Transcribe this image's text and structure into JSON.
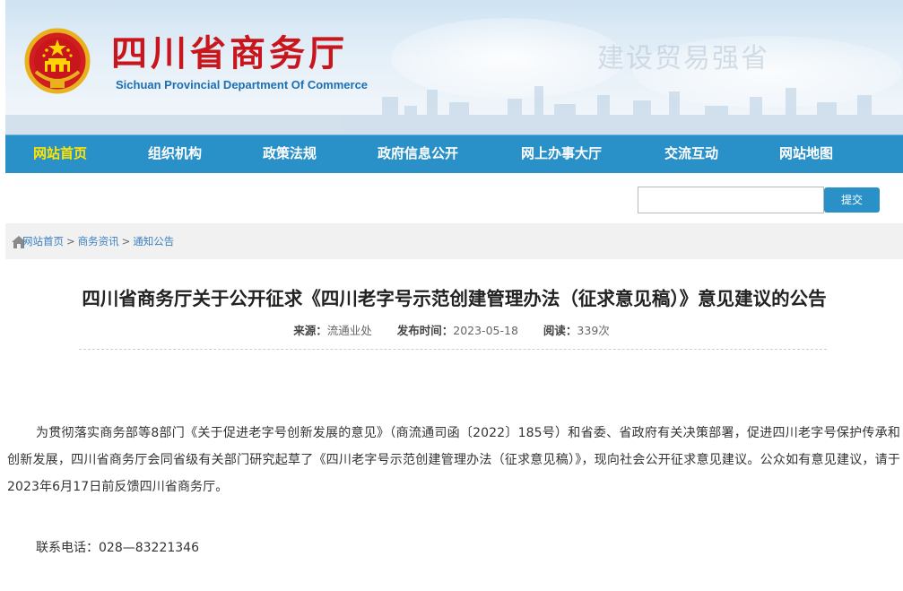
{
  "header": {
    "site_title": "四川省商务厅",
    "site_subtitle": "Sichuan Provincial Department Of Commerce",
    "slogan": "建设贸易强省",
    "colors": {
      "title": "#c9161d",
      "subtitle": "#1d6fb3"
    }
  },
  "nav": {
    "items": [
      {
        "label": "网站首页",
        "active": true
      },
      {
        "label": "组织机构"
      },
      {
        "label": "政策法规"
      },
      {
        "label": "政府信息公开"
      },
      {
        "label": "网上办事大厅"
      },
      {
        "label": "交流互动"
      },
      {
        "label": "网站地图"
      }
    ],
    "colors": {
      "background": "#2a91c8",
      "active": "#ffe400"
    }
  },
  "search": {
    "value": "",
    "placeholder": "",
    "button_label": "提交"
  },
  "breadcrumb": {
    "icon": "home-icon",
    "items": [
      "网站首页",
      "商务资讯",
      "通知公告"
    ],
    "separator": ">"
  },
  "article": {
    "title": "四川省商务厅关于公开征求《四川老字号示范创建管理办法（征求意见稿）》意见建议的公告",
    "meta": {
      "source_label": "来源：",
      "source": "流通业处",
      "date_label": "发布时间：",
      "date": "2023-05-18",
      "views_label": "阅读：",
      "views": "339次"
    },
    "body": "为贯彻落实商务部等8部门《关于促进老字号创新发展的意见》（商流通司函〔2022〕185号）和省委、省政府有关决策部署，促进四川老字号保护传承和创新发展，四川省商务厅会同省级有关部门研究起草了《四川老字号示范创建管理办法（征求意见稿）》，现向社会公开征求意见建议。公众如有意见建议，请于2023年6月17日前反馈四川省商务厅。",
    "contact": "联系电话：028—83221346"
  }
}
